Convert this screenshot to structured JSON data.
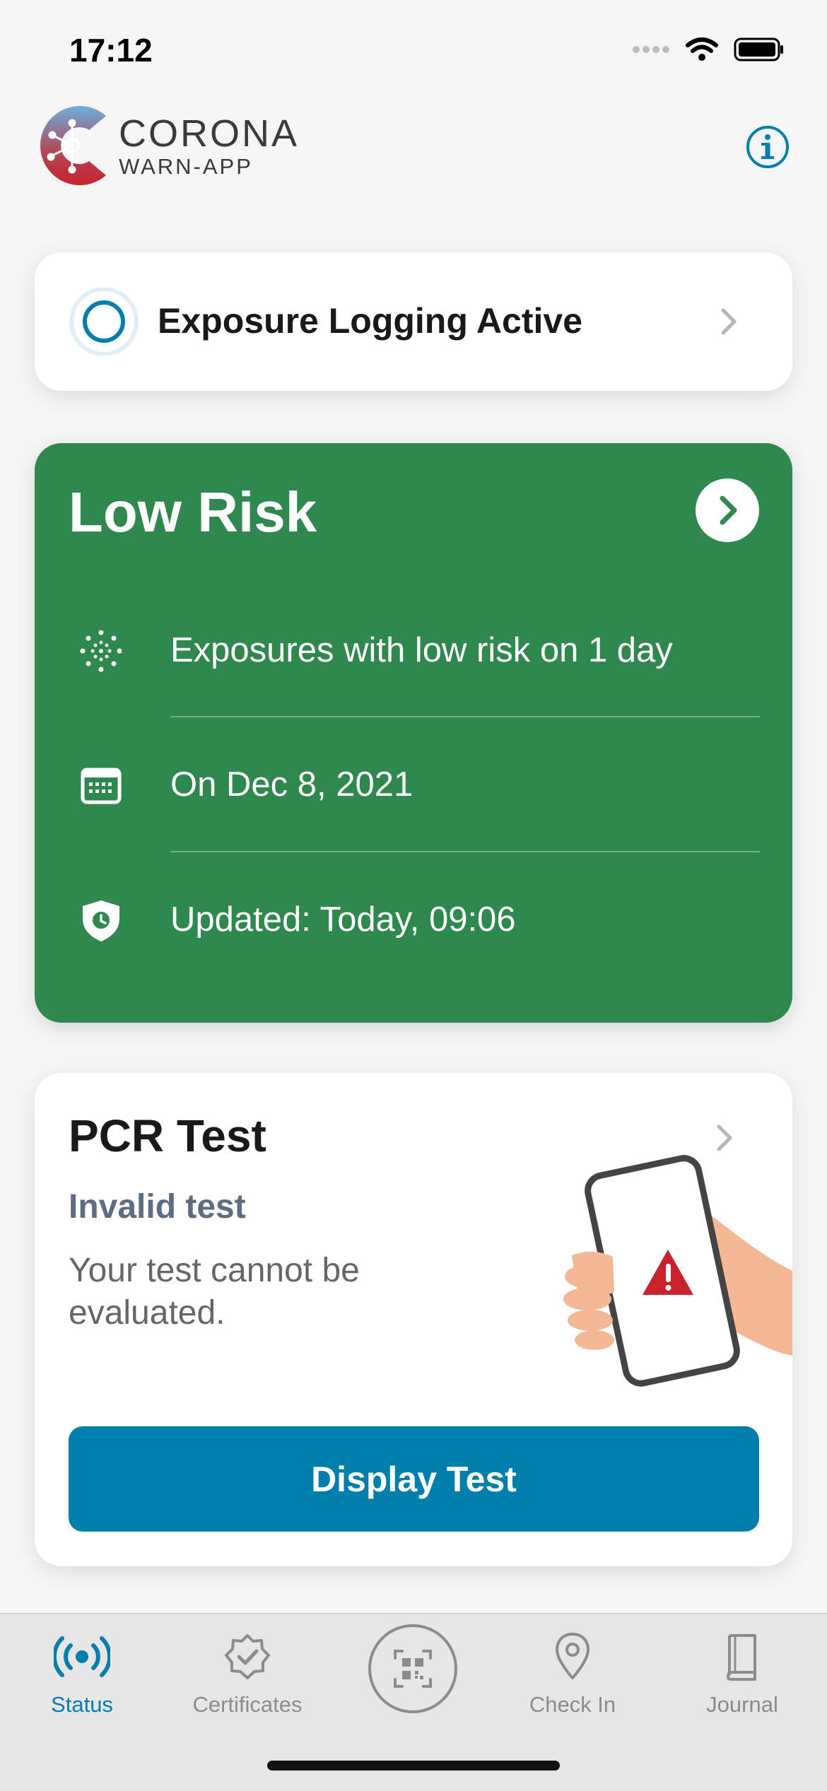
{
  "status_bar": {
    "time": "17:12"
  },
  "header": {
    "brand_line1": "CORONA",
    "brand_line2": "WARN-APP",
    "info_icon": "info-circle-icon"
  },
  "exposure_card": {
    "label": "Exposure Logging Active",
    "icon": "exposure-ring-icon"
  },
  "risk_card": {
    "title": "Low Risk",
    "color": "#2f884e",
    "rows": [
      {
        "icon": "virus-dots-icon",
        "text": "Exposures with low risk on 1 day"
      },
      {
        "icon": "calendar-icon",
        "text": "On Dec 8, 2021"
      },
      {
        "icon": "shield-clock-icon",
        "text": "Updated: Today, 09:06"
      }
    ]
  },
  "pcr_card": {
    "title": "PCR Test",
    "status": "Invalid test",
    "description": "Your test cannot be evaluated.",
    "button_label": "Display Test",
    "accent": "#007fad"
  },
  "tab_bar": {
    "tabs": [
      {
        "label": "Status",
        "icon": "radio-waves-icon",
        "active": true
      },
      {
        "label": "Certificates",
        "icon": "badge-check-icon",
        "active": false
      },
      {
        "label": "",
        "icon": "qr-scan-icon",
        "active": false
      },
      {
        "label": "Check In",
        "icon": "location-pin-icon",
        "active": false
      },
      {
        "label": "Journal",
        "icon": "book-icon",
        "active": false
      }
    ]
  }
}
